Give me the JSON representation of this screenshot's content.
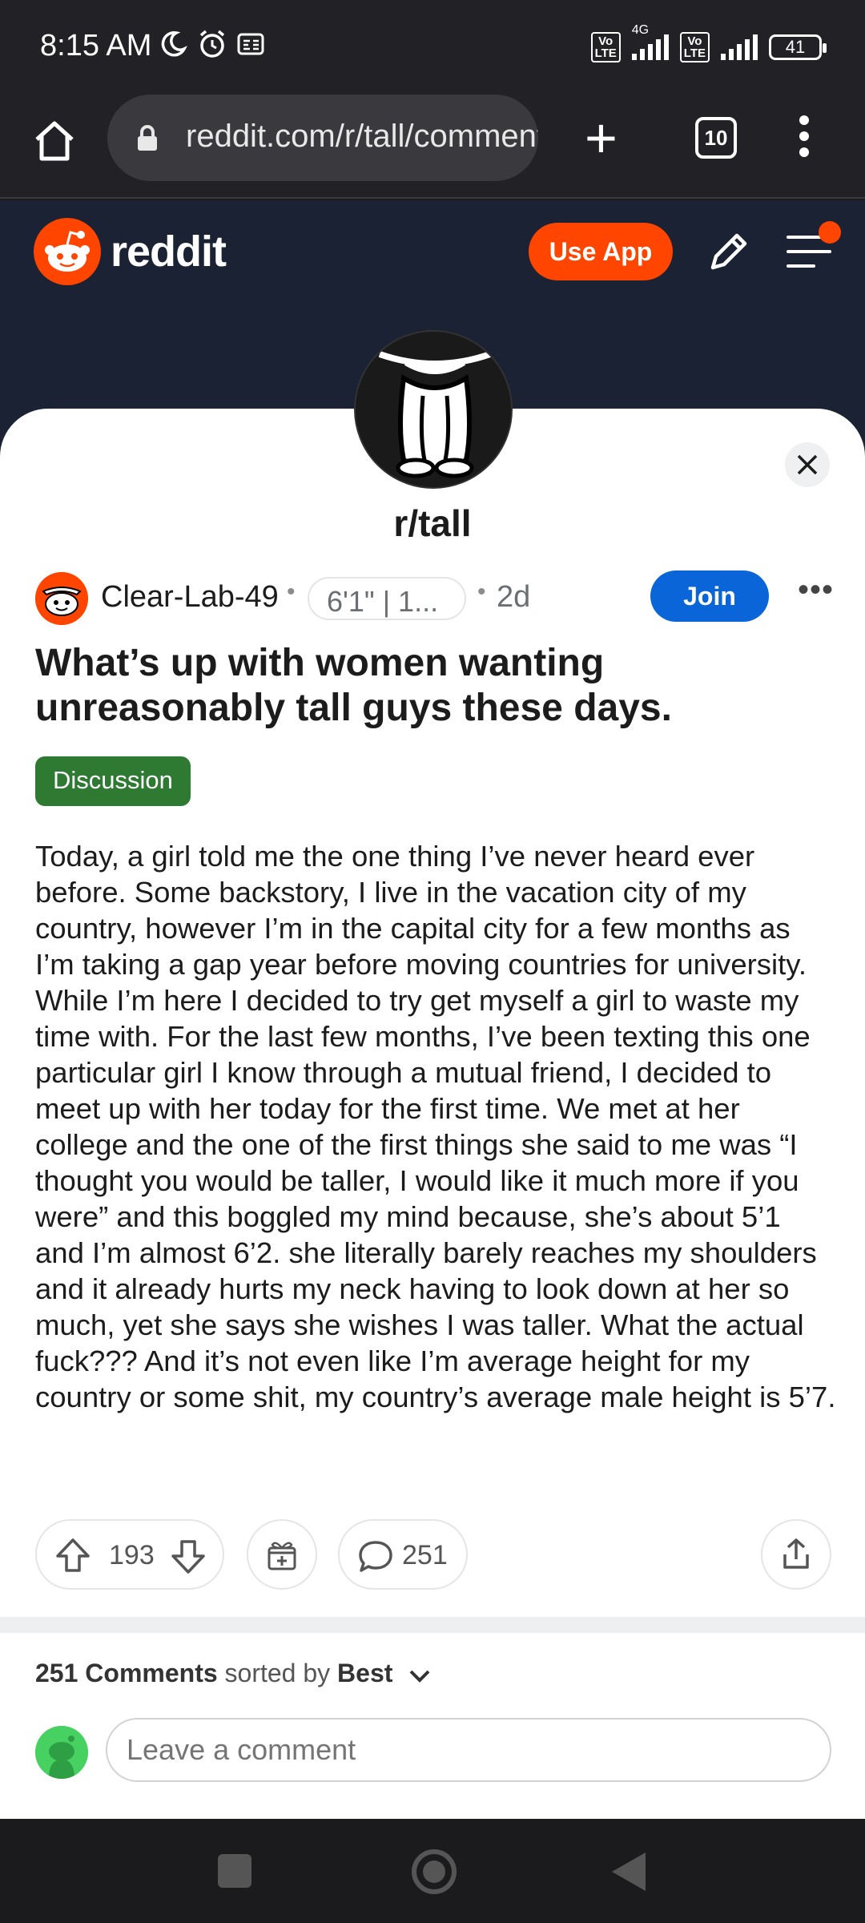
{
  "status_bar": {
    "time": "8:15 AM",
    "network": "4G",
    "battery": "41"
  },
  "browser": {
    "url": "reddit.com/r/tall/comments",
    "tab_count": "10"
  },
  "header": {
    "logo_text": "reddit",
    "use_app_label": "Use App"
  },
  "subreddit": {
    "name": "r/tall"
  },
  "post": {
    "author": "Clear-Lab-49",
    "author_flair": "6'1\" | 1...",
    "age": "2d",
    "join_label": "Join",
    "more_label": "•••",
    "title": "What’s up with women wanting unreasonably tall guys these days.",
    "flair": "Discussion",
    "body": "Today, a girl told me the one thing I’ve never heard ever before. Some backstory, I live in the vacation city of my country, however I’m in the capital city for a few months as I’m taking a gap year before moving countries for university. While I’m here I decided to try get myself a girl to waste my time with. For the last few months, I’ve been texting this one particular girl I know through a mutual friend, I decided to meet up with her today for the first time. We met at her college and the one of the first things she said to me was “I thought you would be taller, I would like it much more if you were” and this boggled my mind because, she’s about 5’1 and I’m almost 6’2. she literally barely reaches my shoulders and it already hurts my neck having to look down at her so much, yet she says she wishes I was taller. What the actual fuck??? And it’s not even like I’m average height for my country or some shit, my country’s average male height is 5’7.",
    "votes": "193",
    "comment_count": "251"
  },
  "comments": {
    "count_label": "251 Comments",
    "sorted_by_label": "sorted by",
    "sort_value": "Best",
    "input_placeholder": "Leave a comment"
  },
  "colors": {
    "reddit_orange": "#ff4500",
    "join_blue": "#0a66d8",
    "flair_green": "#2e7a33",
    "header_navy": "#1a2233"
  }
}
